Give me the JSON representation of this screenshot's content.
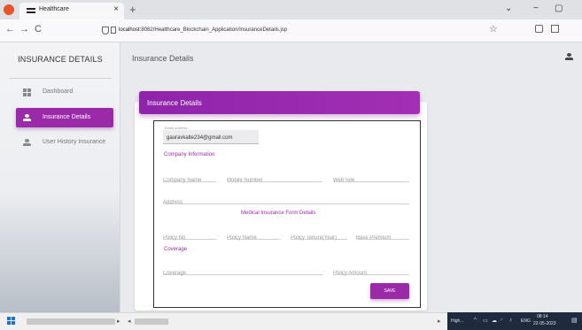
{
  "browser": {
    "tab_title": "Healthcare",
    "tab_close": "×",
    "new_tab": "+",
    "url_host": "localhost",
    "url_rest": ":8082/Healthcare_Blockchain_Application/InsuranceDetails.jsp",
    "back": "←",
    "forward": "→",
    "reload": "C",
    "star": "☆",
    "minimize": "−",
    "maximize": "▢",
    "list_all_tabs": "⌄"
  },
  "sidebar": {
    "brand": "INSURANCE DETAILS",
    "items": [
      {
        "label": "Dashboard",
        "icon": "dashboard-icon"
      },
      {
        "label": "Insurance Details",
        "icon": "user-icon",
        "active": true
      },
      {
        "label": "User History Insurance",
        "icon": "user-icon"
      }
    ]
  },
  "header": {
    "page_title": "Insurance Details"
  },
  "card": {
    "title": "Insurance Details",
    "email_label": "Email address",
    "email_value": "gauravkalte234@gmail.com",
    "company_section": "Company Information",
    "fields": {
      "company_name": "Company Name",
      "mobile_number": "Mobile Number",
      "website": "Web Site",
      "address": "Address"
    },
    "medical_section": "Medical Insurance Form Details",
    "policy": {
      "policy_no": "Policy No",
      "policy_name": "Policy Name",
      "policy_tenure": "Policy Tenure(Year)",
      "base_premium": "Base Premium"
    },
    "coverage_section": "Coverage",
    "coverage_fields": {
      "coverage": "Coverage",
      "policy_amount": "Policy Amount"
    },
    "save_label": "SAVE"
  },
  "taskbar": {
    "high": "High...",
    "lang": "ENG",
    "time": "08:14",
    "date": "22-05-2023"
  },
  "colors": {
    "accent": "#9b2aa8",
    "header_gradient_start": "#8e24aa"
  }
}
